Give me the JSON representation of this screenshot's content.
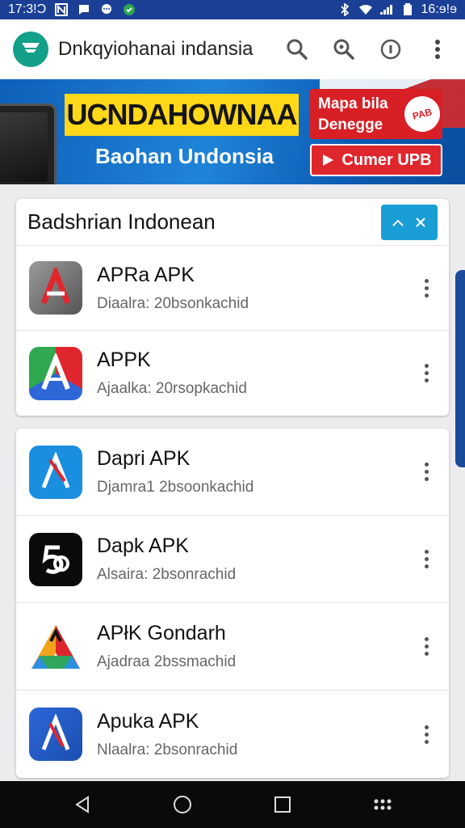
{
  "status_bar": {
    "time_left": "17:3!Ɔ",
    "time_right": "16:ɘ!ɘ"
  },
  "app_bar": {
    "title": "Dnkqyiohanai indansia"
  },
  "banner": {
    "headline": "UCNDAHOWNAA",
    "subtitle": "Baohan Undonsia",
    "promo_line1": "Mapa bila",
    "promo_line2": "Denegge",
    "seal_text": "PAB",
    "cta_label": "Cumer UPB"
  },
  "section_1": {
    "title": "Badshrian Indonean",
    "apps": [
      {
        "name": "APRa APK",
        "meta": "Diaalra:  20bsonkachid",
        "icon": "apk-red-gray-icon"
      },
      {
        "name": "APPK",
        "meta": "Ajaalka:  20rsopkachid",
        "icon": "apk-tricolor-icon"
      }
    ]
  },
  "section_2": {
    "apps": [
      {
        "name": "Dapri APK",
        "meta": "Djamra1  2bsoonkachid",
        "icon": "apk-blue-icon"
      },
      {
        "name": "Dapk APK",
        "meta": "Alsaira:  2bsonrachid",
        "icon": "apk-black-icon"
      },
      {
        "name": "APłK Gondarh",
        "meta": "Ajadraa  2bssmachid",
        "icon": "apk-drive-icon"
      },
      {
        "name": "Apuka APK",
        "meta": "Nlaalra:  2bsonrachid",
        "icon": "apk-blue-red-icon"
      }
    ]
  },
  "colors": {
    "status_bar": "#1b3f94",
    "accent": "#1a9ed6",
    "banner_yellow": "#ffd81a",
    "banner_red": "#d91f26",
    "logo_green": "#12a089"
  }
}
